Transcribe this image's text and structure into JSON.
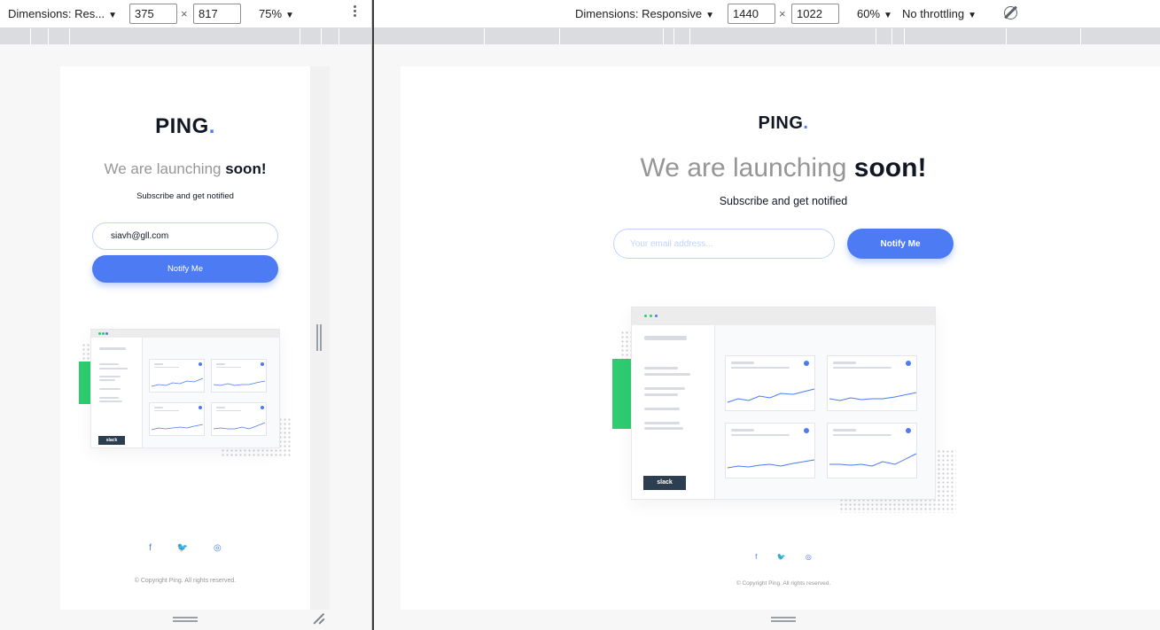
{
  "devtools_left": {
    "dimensions_label": "Dimensions: Res...",
    "width_value": "375",
    "height_value": "817",
    "times": "×",
    "zoom_label": "75%"
  },
  "devtools_right": {
    "dimensions_label": "Dimensions: Responsive",
    "width_value": "1440",
    "height_value": "1022",
    "times": "×",
    "zoom_label": "60%",
    "throttling_label": "No throttling"
  },
  "page": {
    "logo_text": "PING",
    "logo_dot": ".",
    "headline_light": "We are launching ",
    "headline_bold": "soon!",
    "subtext": "Subscribe and get notified",
    "notify_label": "Notify Me",
    "slack_label": "slack",
    "socials": {
      "facebook": "f",
      "twitter": "🐦",
      "instagram": "◎"
    },
    "copyright": "© Copyright Ping. All rights reserved."
  },
  "mobile_form": {
    "email_value": "siavh@gll.com"
  },
  "desktop_form": {
    "email_placeholder": "Your email address..."
  },
  "colors": {
    "brand_blue": "#4c7bf3",
    "dark_navy": "#121725",
    "gray_text": "#969696",
    "pale_blue": "#c2d3ff",
    "green": "#2ecc71"
  },
  "icons": {
    "caret": "▼",
    "kebab": "more-vert-icon",
    "rotate": "rotate-icon"
  }
}
